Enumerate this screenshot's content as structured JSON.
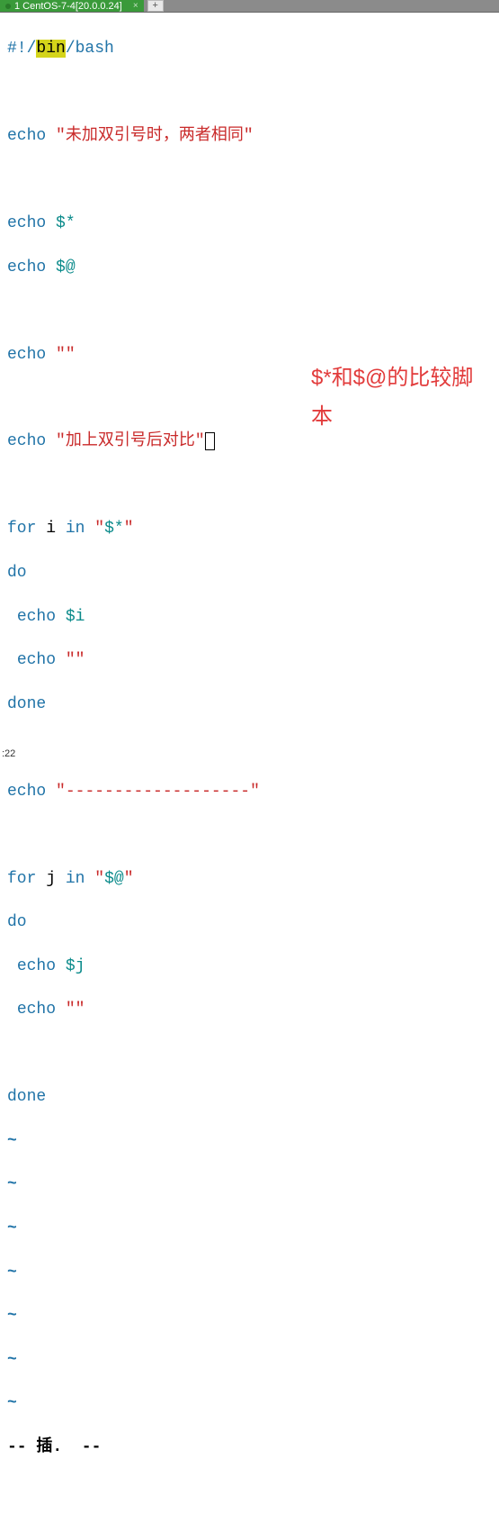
{
  "tab": {
    "label": "1 CentOS-7-4[20.0.0.24]",
    "close": "×",
    "add": "+"
  },
  "code": {
    "shebang_1": "#!/",
    "shebang_bin": "bin",
    "shebang_2": "/bash",
    "echo": "echo",
    "for": "for",
    "in": "in",
    "do": "do",
    "done": "done",
    "q": "\"",
    "str_unquoted": "未加双引号时，两者相同",
    "star": "$*",
    "at": "$@",
    "empty": "",
    "str_quoted": "加上双引号后对比",
    "var_i": "i",
    "dollar_star": "$*",
    "dollar_i": "$i",
    "divider": "-------------------",
    "var_j": "j",
    "dollar_at": "$@",
    "dollar_j": "$j"
  },
  "tildes": "~",
  "status_line": "-- 插.  --",
  "bottom": ":22",
  "annotation": "$*和$@的比较脚本"
}
